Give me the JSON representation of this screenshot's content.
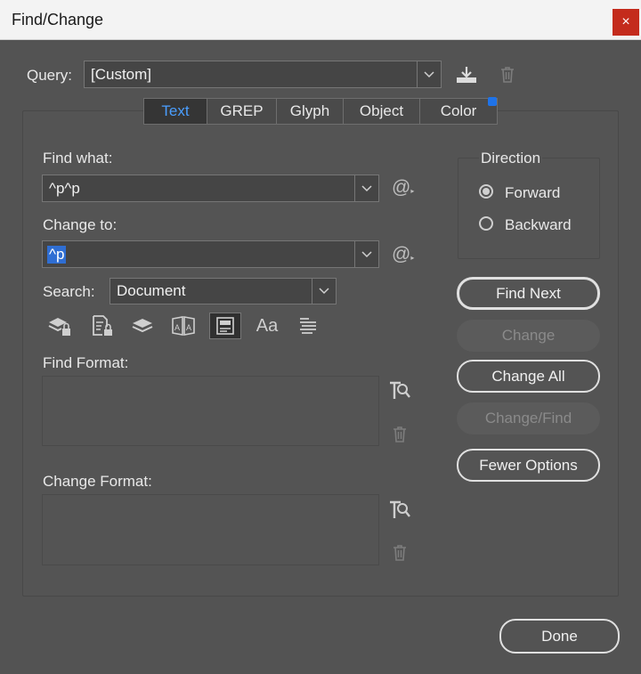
{
  "window": {
    "title": "Find/Change",
    "close_glyph": "×"
  },
  "query": {
    "label": "Query:",
    "value": "[Custom]",
    "save_icon": "save-query-icon",
    "delete_icon": "trash-icon"
  },
  "tabs": [
    {
      "label": "Text",
      "active": true
    },
    {
      "label": "GREP",
      "active": false
    },
    {
      "label": "Glyph",
      "active": false
    },
    {
      "label": "Object",
      "active": false
    },
    {
      "label": "Color",
      "active": false
    }
  ],
  "find_what": {
    "label": "Find what:",
    "value": "^p^p"
  },
  "change_to": {
    "label": "Change to:",
    "value": "^p"
  },
  "search": {
    "label": "Search:",
    "value": "Document"
  },
  "search_options": {
    "icons": [
      "include-locked-layers-icon",
      "include-locked-stories-icon",
      "include-hidden-layers-icon",
      "include-master-pages-icon",
      "include-footnotes-icon",
      "case-sensitive-icon",
      "whole-word-icon"
    ],
    "case_label": "Aa"
  },
  "find_format": {
    "label": "Find Format:"
  },
  "change_format": {
    "label": "Change Format:"
  },
  "direction": {
    "label": "Direction",
    "forward": "Forward",
    "backward": "Backward",
    "selected": "Forward"
  },
  "buttons": {
    "find_next": "Find Next",
    "change": "Change",
    "change_all": "Change All",
    "change_find": "Change/Find",
    "fewer_options": "Fewer Options",
    "done": "Done"
  },
  "colors": {
    "accent_tab": "#4a9eff",
    "selection": "#2f6ed3",
    "close": "#c42b1c",
    "indicator": "#1f73e8"
  }
}
